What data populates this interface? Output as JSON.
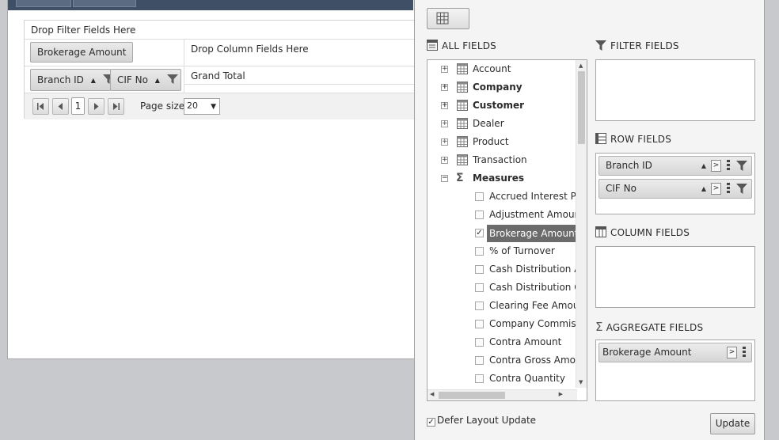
{
  "pivot": {
    "filter_drop_text": "Drop Filter Fields Here",
    "column_drop_text": "Drop Column Fields Here",
    "data_field": "Brokerage Amount",
    "row_fields": [
      "Branch ID",
      "CIF No"
    ],
    "grand_total": "Grand Total",
    "pager": {
      "current_page": "1",
      "page_size_label": "Page size:",
      "page_size": "20"
    }
  },
  "panel": {
    "all_fields_title": "ALL FIELDS",
    "filter_fields_title": "FILTER FIELDS",
    "row_fields_title": "ROW FIELDS",
    "column_fields_title": "COLUMN FIELDS",
    "aggregate_fields_title": "AGGREGATE FIELDS",
    "tree": {
      "dimensions": [
        {
          "label": "Account",
          "bold": false
        },
        {
          "label": "Company",
          "bold": true
        },
        {
          "label": "Customer",
          "bold": true
        },
        {
          "label": "Dealer",
          "bold": false
        },
        {
          "label": "Product",
          "bold": false
        },
        {
          "label": "Transaction",
          "bold": false
        }
      ],
      "measures_label": "Measures",
      "measures": [
        {
          "label": "Accrued Interest Pai",
          "checked": false
        },
        {
          "label": "Adjustment Amoun",
          "checked": false
        },
        {
          "label": "Brokerage Amount",
          "checked": true
        },
        {
          "label": "% of Turnover",
          "checked": false
        },
        {
          "label": "Cash Distribution Ar",
          "checked": false
        },
        {
          "label": "Cash Distribution Qu",
          "checked": false
        },
        {
          "label": "Clearing Fee Amour",
          "checked": false
        },
        {
          "label": "Company Commiss",
          "checked": false
        },
        {
          "label": "Contra Amount",
          "checked": false
        },
        {
          "label": "Contra Gross Amou",
          "checked": false
        },
        {
          "label": "Contra Quantity",
          "checked": false
        }
      ]
    },
    "row_field_chips": [
      "Branch ID",
      "CIF No"
    ],
    "aggregate_field_chips": [
      "Brokerage Amount"
    ],
    "defer_label": "Defer Layout Update",
    "defer_checked": true,
    "update_label": "Update"
  }
}
